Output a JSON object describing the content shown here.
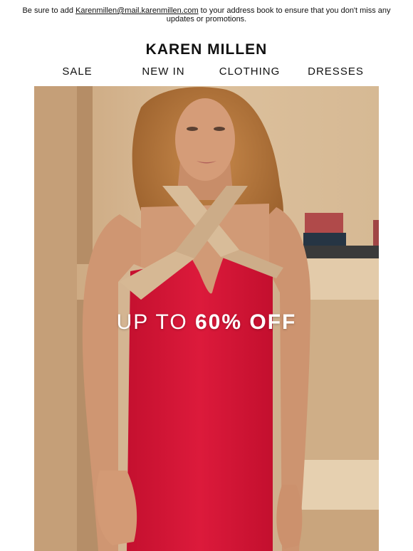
{
  "preheader": {
    "text_before": "Be sure to add ",
    "email_link": "Karenmillen@mail.karenmillen.com",
    "text_after": " to your address book to ensure that you don't miss any",
    "line2": "updates or promotions."
  },
  "brand": {
    "logo_text": "KAREN MILLEN"
  },
  "nav": {
    "items": [
      {
        "label": "SALE"
      },
      {
        "label": "NEW IN"
      },
      {
        "label": "CLOTHING"
      },
      {
        "label": "DRESSES"
      }
    ]
  },
  "hero": {
    "headline_thin": "UP TO ",
    "headline_bold": "60% OFF",
    "colors": {
      "wall": "#d8bc98",
      "dress": "#d81638",
      "trim": "#d4b592",
      "skin": "#cf9672",
      "hair": "#b5773d"
    }
  }
}
